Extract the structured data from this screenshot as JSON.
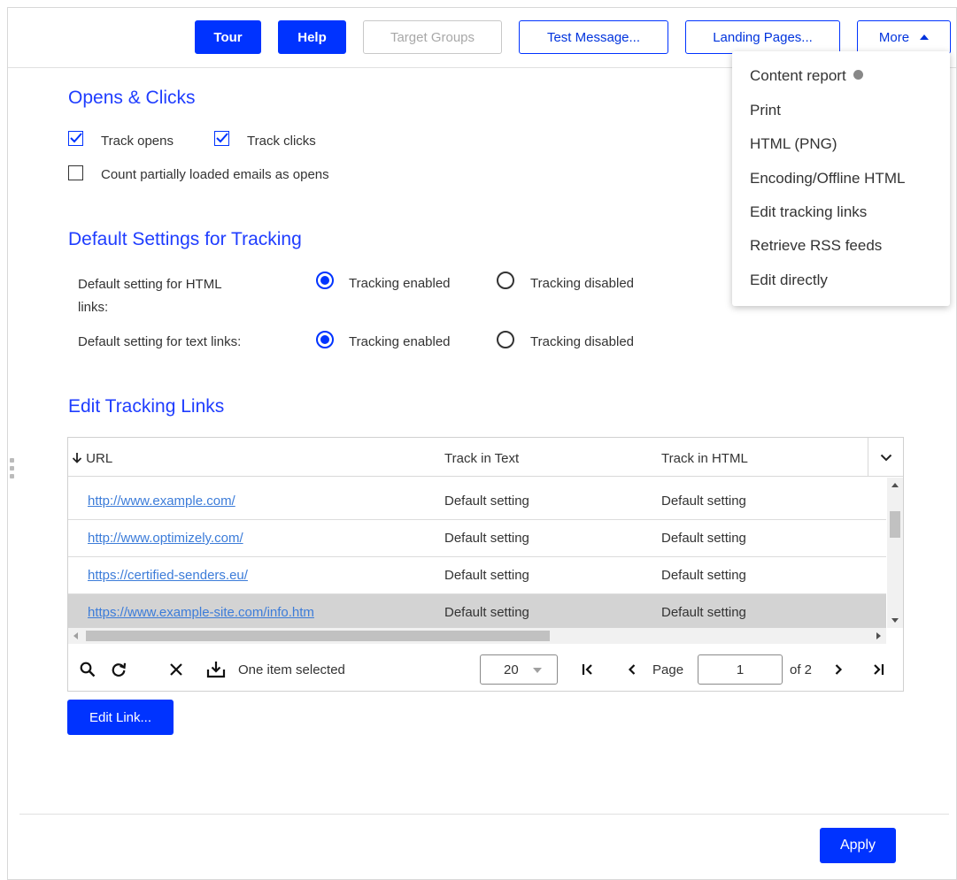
{
  "toolbar": {
    "tour": "Tour",
    "help": "Help",
    "target_groups": "Target Groups",
    "test_message": "Test Message...",
    "landing_pages": "Landing Pages...",
    "more": "More"
  },
  "more_menu": {
    "items": [
      "Content report",
      "Print",
      "HTML (PNG)",
      "Encoding/Offline HTML",
      "Edit tracking links",
      "Retrieve RSS feeds",
      "Edit directly"
    ]
  },
  "opens_clicks": {
    "title": "Opens & Clicks",
    "track_opens": "Track opens",
    "track_clicks": "Track clicks",
    "count_partial": "Count partially loaded emails as opens",
    "track_opens_checked": true,
    "track_clicks_checked": true,
    "count_partial_checked": false
  },
  "default_settings": {
    "title": "Default Settings for Tracking",
    "html_label_line1": "Default setting for HTML",
    "html_label_line2": "links:",
    "text_label": "Default setting for text links:",
    "enabled": "Tracking enabled",
    "disabled": "Tracking disabled",
    "html_value": "enabled",
    "text_value": "enabled"
  },
  "tracking_links": {
    "title": "Edit Tracking Links",
    "columns": [
      "URL",
      "Track in Text",
      "Track in HTML"
    ],
    "rows": [
      {
        "url": "http://www.example.com/",
        "text": "Default setting",
        "html": "Default setting"
      },
      {
        "url": "http://www.optimizely.com/",
        "text": "Default setting",
        "html": "Default setting"
      },
      {
        "url": "https://certified-senders.eu/",
        "text": "Default setting",
        "html": "Default setting"
      },
      {
        "url": "https://www.example-site.com/info.htm",
        "text": "Default setting",
        "html": "Default setting"
      }
    ],
    "selected_row": 3,
    "selection_status": "One item selected",
    "page_size": "20",
    "page_label": "Page",
    "current_page": "1",
    "of_pages": "of 2"
  },
  "edit_link_button": "Edit Link...",
  "apply_button": "Apply",
  "colors": {
    "accent": "#0033ff",
    "heading": "#1f3dff",
    "link": "#3c7cd9",
    "selected_row": "#d3d3d3"
  }
}
